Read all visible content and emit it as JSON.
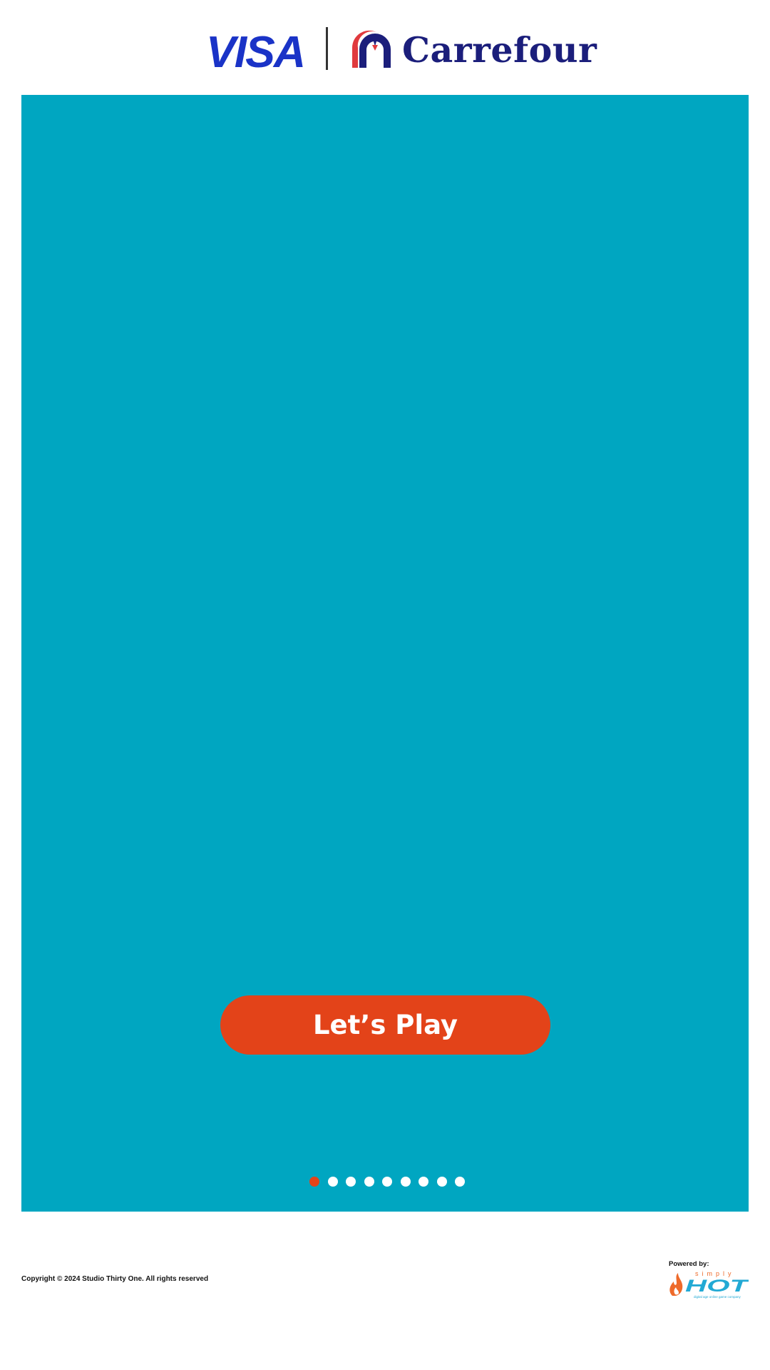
{
  "header": {
    "visa_logo_text": "VISA",
    "carrefour_logo_text": "Carrefour",
    "visa_color": "#1a33c7",
    "carrefour_color": "#1b1e7b",
    "carrefour_accent": "#e03a3e"
  },
  "game": {
    "background_color": "#00a6c1",
    "play_button_label": "Let’s Play",
    "play_button_color": "#e34319",
    "pagination": {
      "total": 9,
      "active_index": 0,
      "active_color": "#e34319",
      "inactive_color": "#ffffff"
    }
  },
  "footer": {
    "copyright": "Copyright © 2024 Studio Thirty One. All rights reserved",
    "powered_by": "Powered by:",
    "simplyhot_logo_text": "simply HOT digital age online game company"
  }
}
